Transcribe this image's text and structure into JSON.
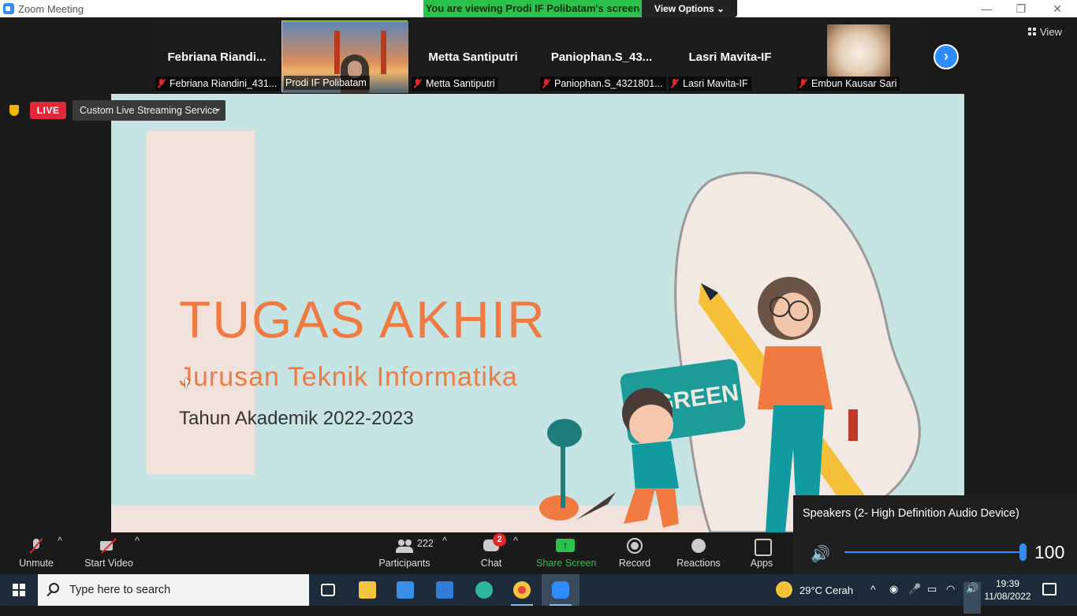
{
  "window": {
    "title": "Zoom Meeting"
  },
  "banner": {
    "sharing_text": "You are viewing Prodi IF Polibatam's screen",
    "view_options": "View Options ⌄"
  },
  "window_controls": {
    "minimize": "—",
    "restore": "❐",
    "close": "✕"
  },
  "gallery": {
    "tiles": [
      {
        "display_name": "Febriana  Riandi...",
        "tag": "Febriana Riandini_431..."
      },
      {
        "display_name": "",
        "tag": "Prodi IF Polibatam"
      },
      {
        "display_name": "Metta Santiputri",
        "tag": "Metta Santiputri"
      },
      {
        "display_name": "Paniophan.S_43...",
        "tag": "Paniophan.S_4321801..."
      },
      {
        "display_name": "Lasri Mavita-IF",
        "tag": "Lasri Mavita-IF"
      },
      {
        "display_name": "",
        "tag": "Embun Kausar Sari"
      }
    ],
    "next": "›",
    "view": "View"
  },
  "live": {
    "badge": "LIVE",
    "stream": "Custom Live Streaming Service"
  },
  "slide": {
    "title": "TUGAS AKHIR",
    "subtitle": "Jurusan Teknik Informatika",
    "year": "Tahun Akademik 2022-2023",
    "puzzle_text": "GREEN",
    "colors": {
      "background": "#c5e4e3",
      "accent": "#f07a41",
      "panel": "#f3e2dc"
    }
  },
  "toolbar": {
    "unmute": "Unmute",
    "start_video": "Start Video",
    "participants": "Participants",
    "participant_count": "222",
    "chat": "Chat",
    "chat_badge": "2",
    "share": "Share Screen",
    "record": "Record",
    "reactions": "Reactions",
    "apps": "Apps",
    "caret": "^"
  },
  "speaker": {
    "device": "Speakers (2- High Definition Audio Device)",
    "volume": "100",
    "volume_fraction": 1.0
  },
  "taskbar": {
    "search_placeholder": "Type here to search",
    "weather": "29°C  Cerah",
    "time": "19:39",
    "date": "11/08/2022"
  }
}
